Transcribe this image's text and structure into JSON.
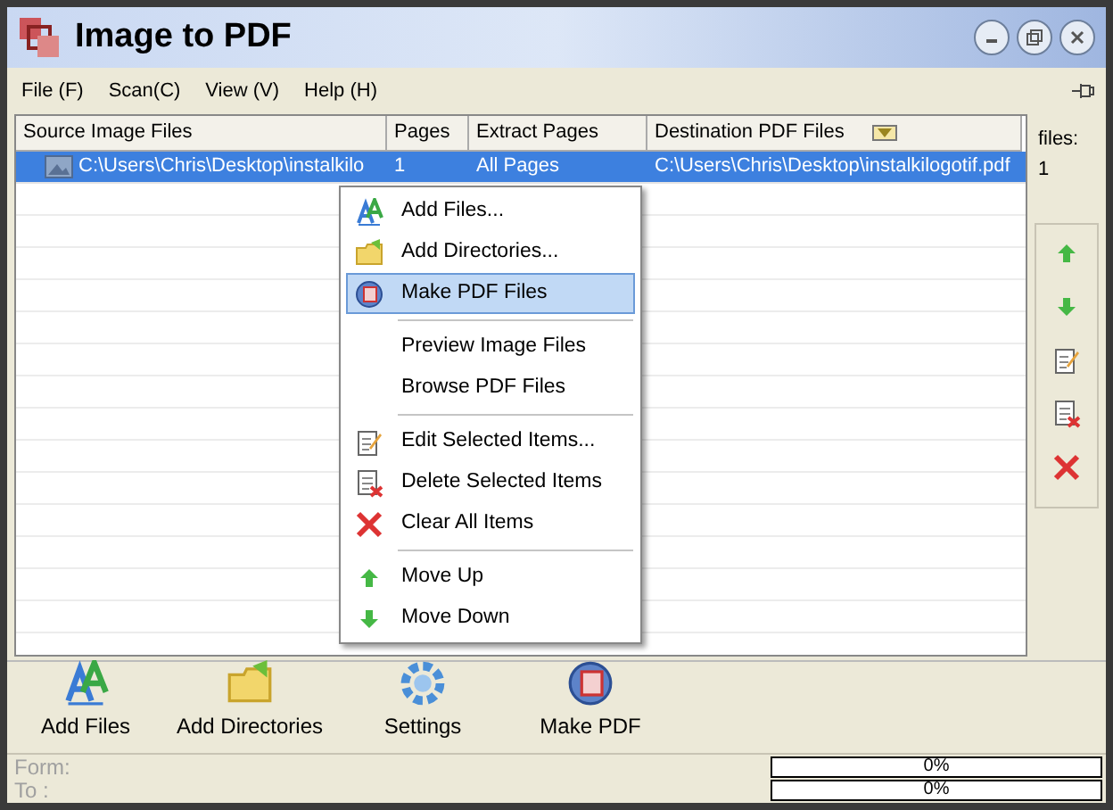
{
  "window": {
    "title": "Image to PDF"
  },
  "menu": [
    {
      "label": "File (F)"
    },
    {
      "label": "Scan(C)"
    },
    {
      "label": "View (V)"
    },
    {
      "label": "Help (H)"
    }
  ],
  "table": {
    "columns": [
      "Source Image Files",
      "Pages",
      "Extract Pages",
      "Destination PDF Files"
    ],
    "rows": [
      {
        "cells": [
          "C:\\Users\\Chris\\Desktop\\instalkilo",
          "1",
          "All Pages",
          "C:\\Users\\Chris\\Desktop\\instalkilogotif.pdf"
        ],
        "selected": true
      }
    ]
  },
  "files_count": {
    "label": "files:",
    "value": "1"
  },
  "side_tools": [
    {
      "kind": "up"
    },
    {
      "kind": "down"
    },
    {
      "kind": "edit"
    },
    {
      "kind": "delete"
    },
    {
      "kind": "clear"
    }
  ],
  "context_menu": [
    {
      "kind": "add",
      "label": "Add Files...",
      "selected": false
    },
    {
      "kind": "folder",
      "label": "Add Directories...",
      "selected": false
    },
    {
      "kind": "pdf",
      "label": "Make PDF Files",
      "selected": true
    },
    {
      "kind": "separator"
    },
    {
      "kind": "plain",
      "label": "Preview Image Files",
      "selected": false
    },
    {
      "kind": "plain",
      "label": "Browse PDF Files",
      "selected": false
    },
    {
      "kind": "separator"
    },
    {
      "kind": "edit",
      "label": "Edit Selected Items...",
      "selected": false
    },
    {
      "kind": "delete",
      "label": "Delete Selected Items",
      "selected": false
    },
    {
      "kind": "clear",
      "label": "Clear All Items",
      "selected": false
    },
    {
      "kind": "separator"
    },
    {
      "kind": "up",
      "label": "Move Up",
      "selected": false
    },
    {
      "kind": "down",
      "label": "Move Down",
      "selected": false
    }
  ],
  "toolbar": [
    {
      "kind": "add",
      "label": "Add Files"
    },
    {
      "kind": "folder",
      "label": "Add Directories"
    },
    {
      "kind": "gear",
      "label": "Settings"
    },
    {
      "kind": "pdf",
      "label": "Make PDF"
    }
  ],
  "status": {
    "form_label": "Form:",
    "to_label": "To :",
    "form_progress": {
      "level": 0,
      "reading": "0%"
    },
    "to_progress": {
      "level": 0,
      "reading": "0%"
    }
  }
}
